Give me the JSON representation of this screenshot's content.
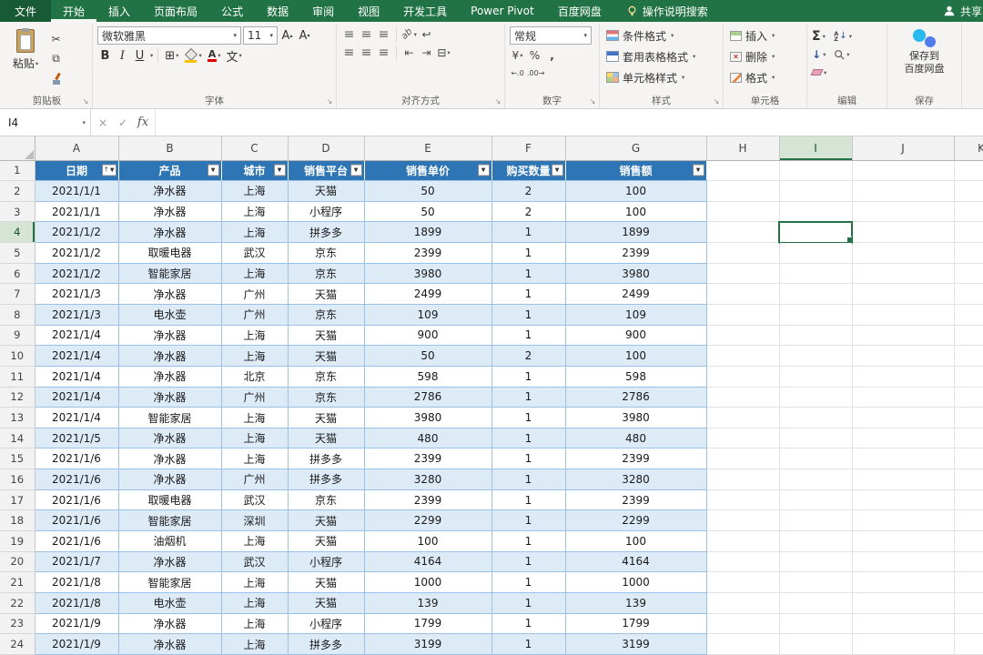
{
  "icons": {
    "caret": "▾",
    "launcher": "↘",
    "scissors": "✂",
    "copy": "⧉",
    "borders": "⊞",
    "merge": "⊟",
    "align_lines": "≡",
    "orientation_ab": "ab",
    "wrap_arrow": "↩",
    "indent_left": "⇤",
    "indent_right": "⇥",
    "currency": "¥",
    "percent": "%",
    "comma": ",",
    "dec_increase": "←.0",
    "dec_decrease": ".00→",
    "sum": "Σ",
    "sort_a": "A",
    "sort_z": "Z",
    "sort_arrow": "↓",
    "fill_arrow": "↓",
    "font_grow": "A",
    "grow_caret": "▴",
    "font_shrink": "A",
    "shrink_caret": "▾",
    "font_color_letter": "A",
    "phonetic": "文",
    "delete_x": "✕",
    "filter_arrow": "▼",
    "cancel": "×",
    "enter": "✓",
    "fx": "fx"
  },
  "tab_bar": {
    "file_tab": "文件",
    "tabs": [
      "开始",
      "插入",
      "页面布局",
      "公式",
      "数据",
      "审阅",
      "视图",
      "开发工具",
      "Power Pivot",
      "百度网盘"
    ],
    "active_tab": "开始",
    "tell_me": "操作说明搜索",
    "share": "共享"
  },
  "ribbon": {
    "clipboard": {
      "label": "剪贴板",
      "paste": "粘贴"
    },
    "font": {
      "label": "字体",
      "name": "微软雅黑",
      "size": "11",
      "bold": "B",
      "italic": "I",
      "underline": "U"
    },
    "alignment": {
      "label": "对齐方式"
    },
    "number": {
      "label": "数字",
      "format": "常规"
    },
    "styles": {
      "label": "样式",
      "conditional": "条件格式",
      "format_table": "套用表格格式",
      "cell_styles": "单元格样式"
    },
    "cells": {
      "label": "单元格",
      "insert": "插入",
      "delete": "删除",
      "format": "格式"
    },
    "editing": {
      "label": "编辑"
    },
    "save": {
      "label": "保存",
      "button_line1": "保存到",
      "button_line2": "百度网盘"
    }
  },
  "formula_bar": {
    "name_box": "I4",
    "value": ""
  },
  "sheet": {
    "col_headers": [
      "A",
      "B",
      "C",
      "D",
      "E",
      "F",
      "G",
      "H",
      "I",
      "J",
      "K"
    ],
    "first_row_number": "1",
    "selection": {
      "col": "I",
      "row": "4",
      "ref": "I4"
    },
    "table": {
      "headers": [
        {
          "label": "日期",
          "sort": "↑"
        },
        {
          "label": "产品",
          "sort": ""
        },
        {
          "label": "城市",
          "sort": ""
        },
        {
          "label": "销售平台",
          "sort": ""
        },
        {
          "label": "销售单价",
          "sort": ""
        },
        {
          "label": "购买数量",
          "sort": ""
        },
        {
          "label": "销售额",
          "sort": ""
        }
      ],
      "rows": [
        {
          "n": "2",
          "cells": [
            "2021/1/1",
            "净水器",
            "上海",
            "天猫",
            "50",
            "2",
            "100"
          ]
        },
        {
          "n": "3",
          "cells": [
            "2021/1/1",
            "净水器",
            "上海",
            "小程序",
            "50",
            "2",
            "100"
          ]
        },
        {
          "n": "4",
          "cells": [
            "2021/1/2",
            "净水器",
            "上海",
            "拼多多",
            "1899",
            "1",
            "1899"
          ]
        },
        {
          "n": "5",
          "cells": [
            "2021/1/2",
            "取暖电器",
            "武汉",
            "京东",
            "2399",
            "1",
            "2399"
          ]
        },
        {
          "n": "6",
          "cells": [
            "2021/1/2",
            "智能家居",
            "上海",
            "京东",
            "3980",
            "1",
            "3980"
          ]
        },
        {
          "n": "7",
          "cells": [
            "2021/1/3",
            "净水器",
            "广州",
            "天猫",
            "2499",
            "1",
            "2499"
          ]
        },
        {
          "n": "8",
          "cells": [
            "2021/1/3",
            "电水壶",
            "广州",
            "京东",
            "109",
            "1",
            "109"
          ]
        },
        {
          "n": "9",
          "cells": [
            "2021/1/4",
            "净水器",
            "上海",
            "天猫",
            "900",
            "1",
            "900"
          ]
        },
        {
          "n": "10",
          "cells": [
            "2021/1/4",
            "净水器",
            "上海",
            "天猫",
            "50",
            "2",
            "100"
          ]
        },
        {
          "n": "11",
          "cells": [
            "2021/1/4",
            "净水器",
            "北京",
            "京东",
            "598",
            "1",
            "598"
          ]
        },
        {
          "n": "12",
          "cells": [
            "2021/1/4",
            "净水器",
            "广州",
            "京东",
            "2786",
            "1",
            "2786"
          ]
        },
        {
          "n": "13",
          "cells": [
            "2021/1/4",
            "智能家居",
            "上海",
            "天猫",
            "3980",
            "1",
            "3980"
          ]
        },
        {
          "n": "14",
          "cells": [
            "2021/1/5",
            "净水器",
            "上海",
            "天猫",
            "480",
            "1",
            "480"
          ]
        },
        {
          "n": "15",
          "cells": [
            "2021/1/6",
            "净水器",
            "上海",
            "拼多多",
            "2399",
            "1",
            "2399"
          ]
        },
        {
          "n": "16",
          "cells": [
            "2021/1/6",
            "净水器",
            "广州",
            "拼多多",
            "3280",
            "1",
            "3280"
          ]
        },
        {
          "n": "17",
          "cells": [
            "2021/1/6",
            "取暖电器",
            "武汉",
            "京东",
            "2399",
            "1",
            "2399"
          ]
        },
        {
          "n": "18",
          "cells": [
            "2021/1/6",
            "智能家居",
            "深圳",
            "天猫",
            "2299",
            "1",
            "2299"
          ]
        },
        {
          "n": "19",
          "cells": [
            "2021/1/6",
            "油烟机",
            "上海",
            "天猫",
            "100",
            "1",
            "100"
          ]
        },
        {
          "n": "20",
          "cells": [
            "2021/1/7",
            "净水器",
            "武汉",
            "小程序",
            "4164",
            "1",
            "4164"
          ]
        },
        {
          "n": "21",
          "cells": [
            "2021/1/8",
            "智能家居",
            "上海",
            "天猫",
            "1000",
            "1",
            "1000"
          ]
        },
        {
          "n": "22",
          "cells": [
            "2021/1/8",
            "电水壶",
            "上海",
            "天猫",
            "139",
            "1",
            "139"
          ]
        },
        {
          "n": "23",
          "cells": [
            "2021/1/9",
            "净水器",
            "上海",
            "小程序",
            "1799",
            "1",
            "1799"
          ]
        },
        {
          "n": "24",
          "cells": [
            "2021/1/9",
            "净水器",
            "上海",
            "拼多多",
            "3199",
            "1",
            "3199"
          ]
        }
      ]
    }
  },
  "colors": {
    "excel_green": "#217346",
    "table_header_blue": "#2E75B6",
    "band_blue": "#DDEBF7",
    "table_border": "#9BC2E6"
  }
}
